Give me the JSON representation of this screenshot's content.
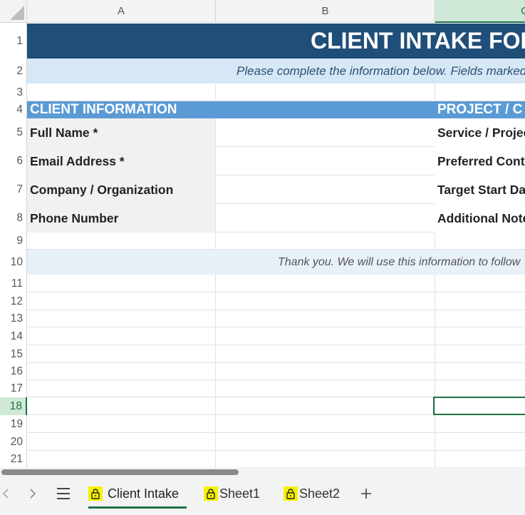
{
  "columns": [
    "A",
    "B",
    "C"
  ],
  "rows": [
    "1",
    "2",
    "3",
    "4",
    "5",
    "6",
    "7",
    "8",
    "9",
    "10",
    "11",
    "12",
    "13",
    "14",
    "15",
    "16",
    "17",
    "18",
    "19",
    "20",
    "21"
  ],
  "selected_row": "18",
  "selected_col": "C",
  "form": {
    "title": "CLIENT INTAKE FORM",
    "subtitle": "Please complete the information below. Fields marked",
    "section_client": "CLIENT INFORMATION",
    "section_project": "PROJECT / C",
    "client_fields": [
      "Full Name *",
      "Email Address *",
      "Company / Organization",
      "Phone Number"
    ],
    "project_fields": [
      "Service / Project",
      "Preferred Contact",
      "Target Start Date",
      "Additional Notes"
    ],
    "thanks": "Thank you. We will use this information to follow"
  },
  "bottom_bar": {
    "prev_icon": "chevron-left-icon",
    "next_icon": "chevron-right-icon",
    "menu_icon": "hamburger-menu-icon",
    "add_icon": "plus-icon",
    "tabs": [
      {
        "label": "Client Intake",
        "locked": true,
        "active": true
      },
      {
        "label": "Sheet1",
        "locked": true,
        "active": false
      },
      {
        "label": "Sheet2",
        "locked": true,
        "active": false
      }
    ]
  },
  "colors": {
    "title_band": "#1f4e79",
    "section_band": "#5b9bd5",
    "selection": "#1e7145",
    "lock_highlight": "#f5f200"
  }
}
